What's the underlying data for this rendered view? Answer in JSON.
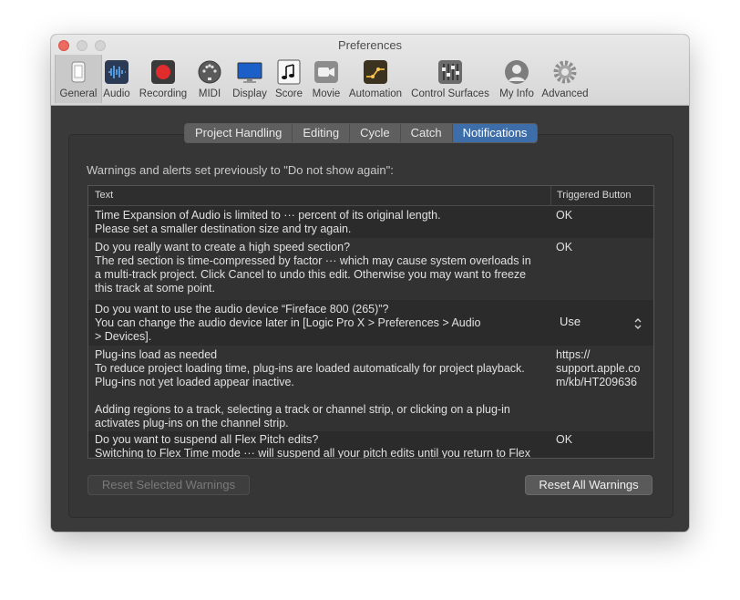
{
  "window": {
    "title": "Preferences"
  },
  "toolbar": {
    "items": [
      {
        "label": "General",
        "icon": "general-icon",
        "selected": true
      },
      {
        "label": "Audio",
        "icon": "audio-icon"
      },
      {
        "label": "Recording",
        "icon": "recording-icon"
      },
      {
        "label": "MIDI",
        "icon": "midi-icon"
      },
      {
        "label": "Display",
        "icon": "display-icon"
      },
      {
        "label": "Score",
        "icon": "score-icon"
      },
      {
        "label": "Movie",
        "icon": "movie-icon"
      },
      {
        "label": "Automation",
        "icon": "automation-icon"
      },
      {
        "label": "Control Surfaces",
        "icon": "control-surfaces-icon"
      },
      {
        "label": "My Info",
        "icon": "my-info-icon"
      },
      {
        "label": "Advanced",
        "icon": "advanced-icon"
      }
    ]
  },
  "tabs": [
    {
      "label": "Project Handling"
    },
    {
      "label": "Editing"
    },
    {
      "label": "Cycle"
    },
    {
      "label": "Catch"
    },
    {
      "label": "Notifications",
      "active": true
    }
  ],
  "notifications": {
    "intro": "Warnings and alerts set previously to \"Do not show again\":",
    "columns": {
      "text": "Text",
      "triggered": "Triggered Button"
    },
    "rows": [
      {
        "lines": [
          "Time Expansion of Audio is limited to ··· percent of its original length.",
          "Please set a smaller destination size and try again."
        ],
        "triggered": "OK"
      },
      {
        "lines": [
          "Do you really want to create a high speed section?",
          "The red section is time-compressed by factor ··· which may cause system overloads in",
          "a multi-track project. Click Cancel to undo this edit. Otherwise you may want to freeze",
          "this track at some point."
        ],
        "triggered": "OK"
      },
      {
        "lines": [
          "Do you want to use the audio device “Fireface 800 (265)”?",
          "You can change the audio device later in [Logic Pro X > Preferences > Audio",
          "> Devices]."
        ],
        "triggered": "Use"
      },
      {
        "lines": [
          "Plug-ins load as needed",
          "To reduce project loading time, plug-ins are loaded automatically for project playback.",
          "Plug-ins not yet loaded appear inactive.",
          "",
          "Adding regions to a track, selecting a track or channel strip, or clicking on a plug-in",
          "activates plug-ins on the channel strip."
        ],
        "triggered_lines": [
          "https://",
          "support.apple.co",
          "m/kb/HT209636"
        ]
      },
      {
        "lines": [
          "Do you want to suspend all Flex Pitch edits?",
          "Switching to Flex Time mode ··· will suspend all your pitch edits until you return to Flex"
        ],
        "triggered": "OK"
      }
    ]
  },
  "buttons": {
    "reset_selected": "Reset Selected Warnings",
    "reset_all": "Reset All Warnings"
  },
  "colors": {
    "accent": "#3d6ea9",
    "close": "#ee6a5f",
    "panel": "#3a3a3a"
  }
}
